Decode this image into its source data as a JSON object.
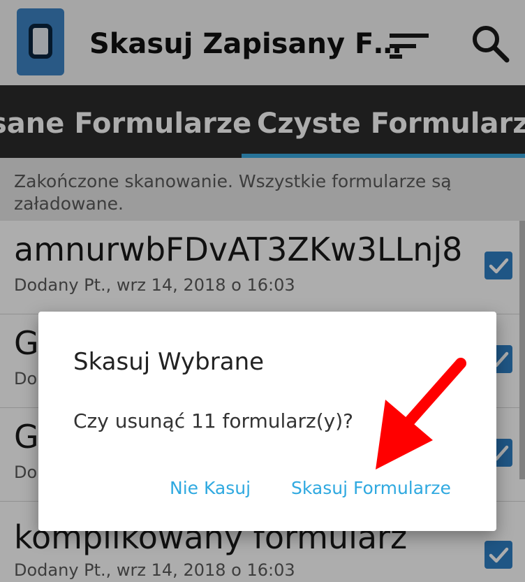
{
  "app_bar": {
    "title": "Skasuj Zapisany F…",
    "sort_icon": "sort-icon",
    "search_icon": "search-icon"
  },
  "tabs": [
    {
      "label": "sane Formularze",
      "selected": false
    },
    {
      "label": "Czyste Formularze",
      "selected": true
    }
  ],
  "status": "Zakończone skanowanie. Wszystkie formularze są załadowane.",
  "forms": [
    {
      "name": "amnurwbFDvAT3ZKw3LLnj8",
      "added": "Dodany Pt., wrz 14, 2018 o 16:03",
      "checked": true
    },
    {
      "name": "Gl",
      "added": "Do",
      "checked": true
    },
    {
      "name": "G",
      "added": "Do",
      "checked": true
    },
    {
      "name": "komplikowany formularz",
      "added": "Dodany Pt., wrz 14, 2018 o 16:03",
      "checked": true
    }
  ],
  "dialog": {
    "title": "Skasuj Wybrane",
    "message": "Czy usunąć 11 formularz(y)?",
    "cancel_label": "Nie Kasuj",
    "confirm_label": "Skasuj Formularze"
  },
  "colors": {
    "accent": "#2fa9e0",
    "tab_indicator": "#3aa8df",
    "checkbox": "#2f7fc4",
    "arrow": "#ff0000"
  }
}
